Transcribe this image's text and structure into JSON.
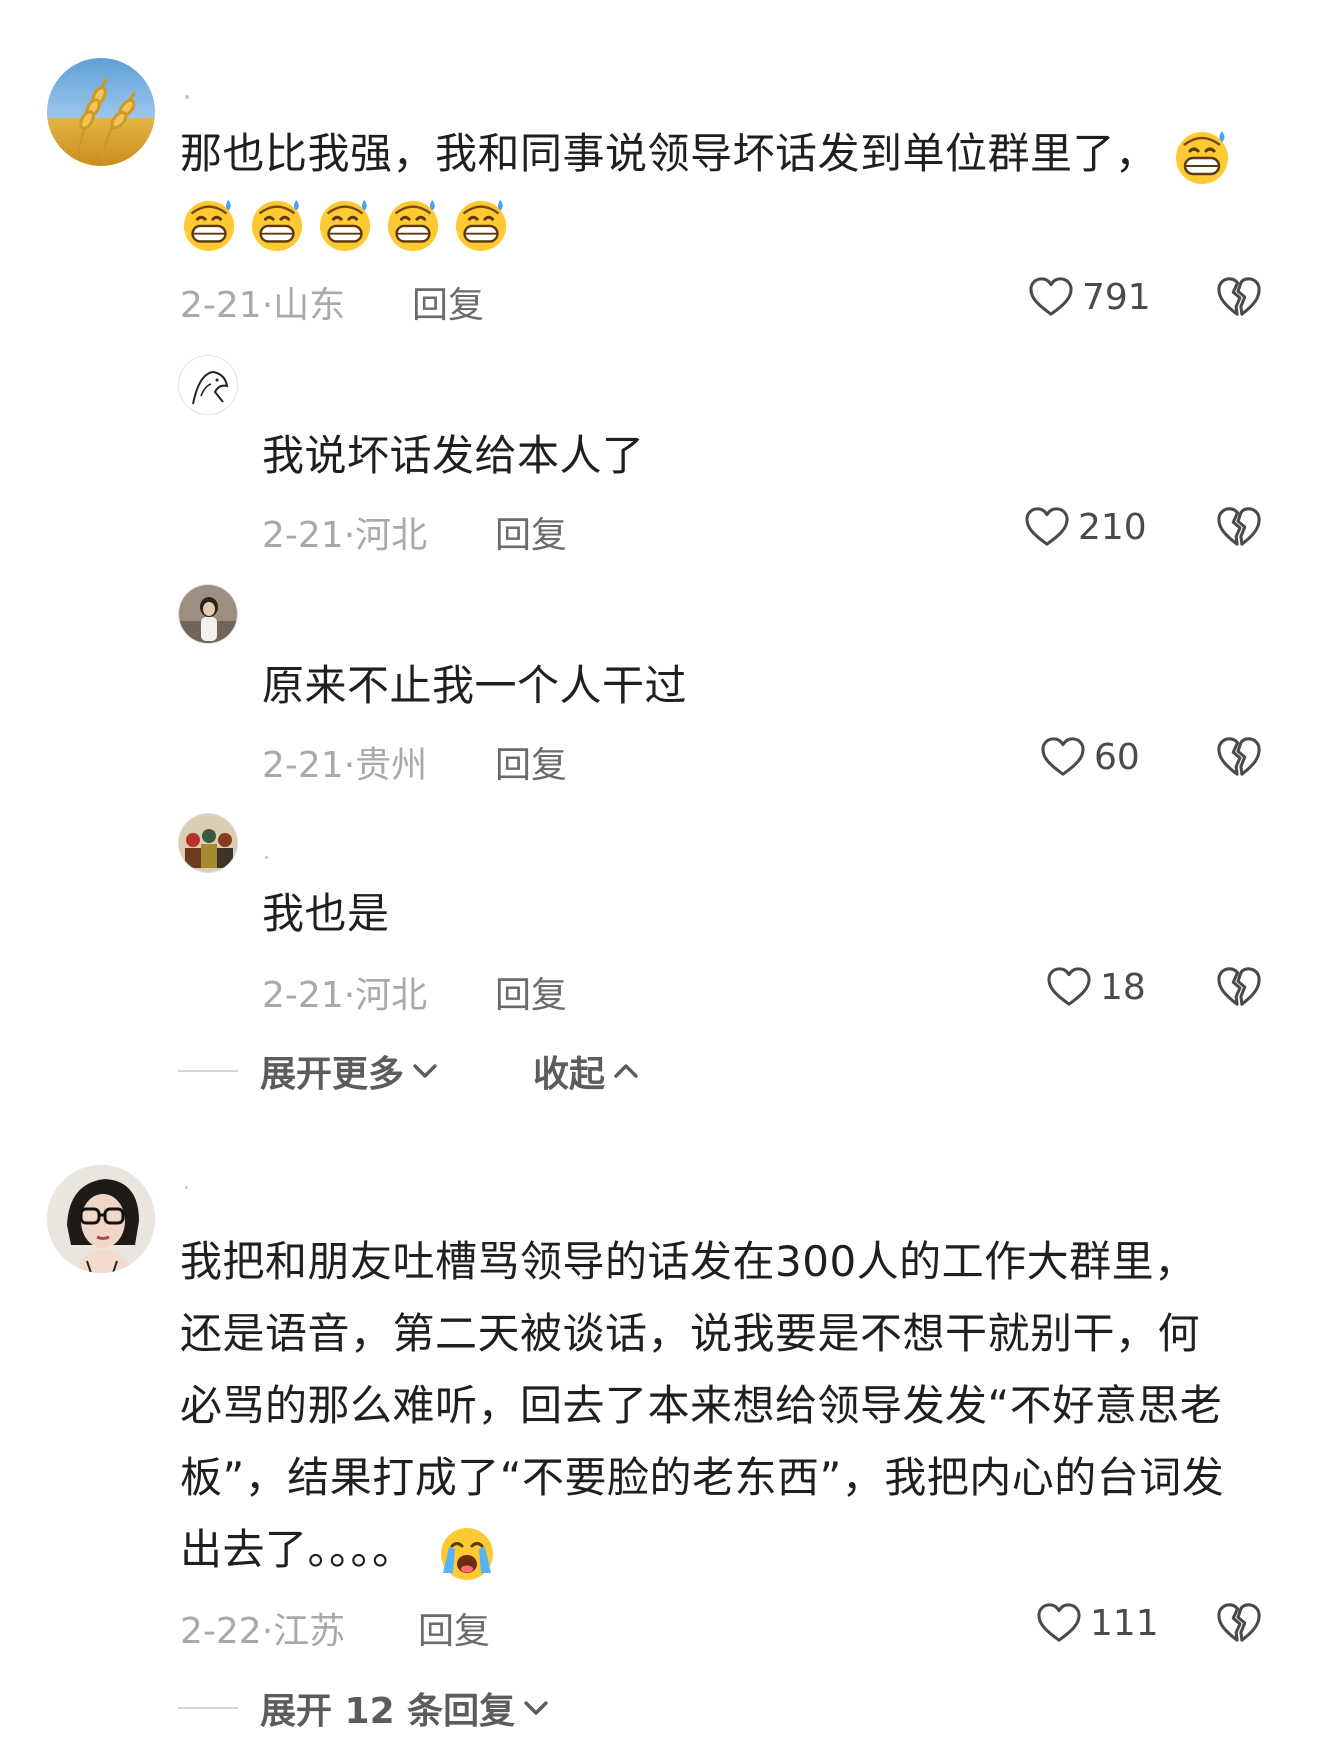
{
  "comments": [
    {
      "text": "那也比我强，我和同事说领导坏话发到单位群里了，",
      "date": "2-21",
      "location": "山东",
      "reply": "回复",
      "likes": "791",
      "avatar": "wheat-avatar"
    },
    {
      "text": "我把和朋友吐槽骂领导的话发在300人的工作大群里，",
      "text_lines": [
        "我把和朋友吐槽骂领导的话发在300人的工作大群里，",
        "还是语音，第二天被谈话，说我要是不想干就别干，何",
        "必骂的那么难听，回去了本来想给领导发发“不好意思老",
        "板”，结果打成了“不要脸的老东西”，我把内心的台词发",
        "出去了。。。。"
      ],
      "date": "2-22",
      "location": "江苏",
      "reply": "回复",
      "likes": "111",
      "avatar": "girl-glasses-avatar",
      "expand": "展开 12 条回复"
    }
  ],
  "replies": [
    {
      "text": "我说坏话发给本人了",
      "date": "2-21",
      "location": "河北",
      "reply": "回复",
      "likes": "210",
      "avatar": "sketch-avatar"
    },
    {
      "text": "原来不止我一个人干过",
      "date": "2-21",
      "location": "贵州",
      "reply": "回复",
      "likes": "60",
      "avatar": "photo-avatar"
    },
    {
      "text": "我也是",
      "date": "2-21",
      "location": "河北",
      "reply": "回复",
      "likes": "18",
      "avatar": "painting-avatar"
    }
  ],
  "thread_controls": {
    "expand_more": "展开更多",
    "collapse": "收起"
  },
  "colors": {
    "text": "#1f1f1f",
    "meta": "#a9a9a9",
    "reply": "#6b6b6b",
    "icon": "#4a4a4a"
  },
  "icons": [
    "heart-icon",
    "broken-heart-icon",
    "chevron-down-icon",
    "chevron-up-icon",
    "grin-sweat-emoji",
    "crying-emoji"
  ]
}
